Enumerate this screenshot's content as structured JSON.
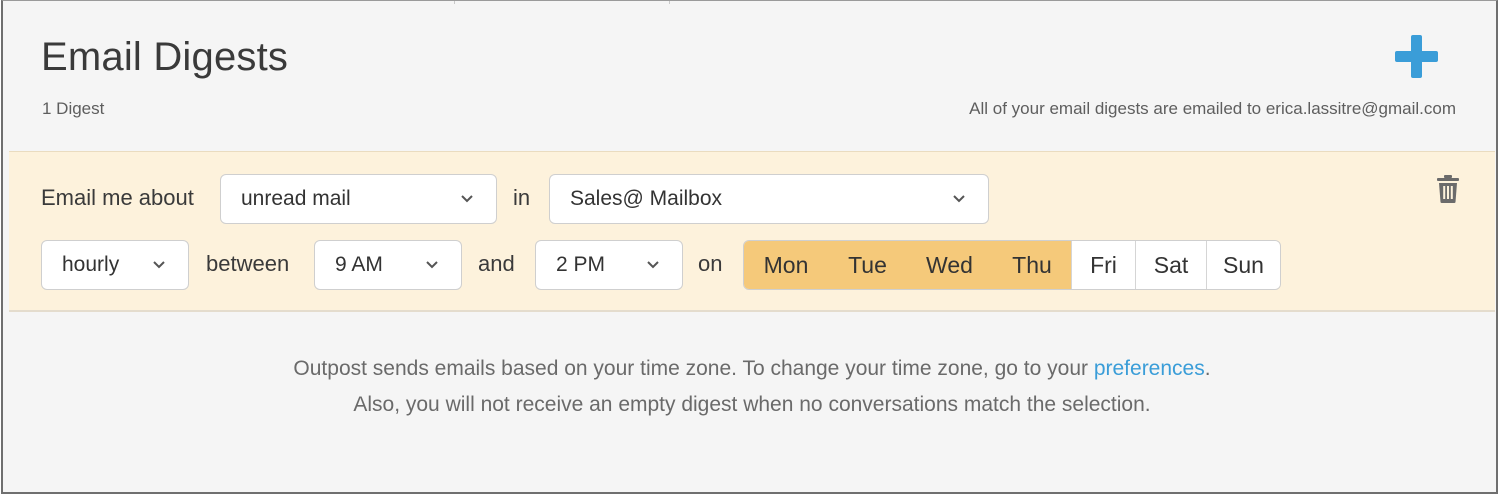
{
  "header": {
    "title": "Email Digests",
    "count_text": "1 Digest",
    "recipient_text": "All of your email digests are emailed to erica.lassitre@gmail.com",
    "add_icon": "plus-icon",
    "add_color": "#3a9dd8"
  },
  "digest": {
    "label_email_me_about": "Email me about",
    "topic_select": {
      "value": "unread mail"
    },
    "label_in": "in",
    "mailbox_select": {
      "value": "Sales@ Mailbox"
    },
    "frequency_select": {
      "value": "hourly"
    },
    "label_between": "between",
    "start_select": {
      "value": "9 AM"
    },
    "label_and": "and",
    "end_select": {
      "value": "2 PM"
    },
    "label_on": "on",
    "days": [
      {
        "label": "Mon",
        "selected": true
      },
      {
        "label": "Tue",
        "selected": true
      },
      {
        "label": "Wed",
        "selected": true
      },
      {
        "label": "Thu",
        "selected": true
      },
      {
        "label": "Fri",
        "selected": false
      },
      {
        "label": "Sat",
        "selected": false
      },
      {
        "label": "Sun",
        "selected": false
      }
    ],
    "delete_icon": "trash-icon",
    "panel_color": "#fdf2dc",
    "selected_day_color": "#f5c97a"
  },
  "footer": {
    "line1_before": "Outpost sends emails based on your time zone. To change your time zone, go to your ",
    "line1_link": "preferences",
    "line1_after": ".",
    "line2": "Also, you will not receive an empty digest when no conversations match the selection.",
    "link_color": "#3a9dd8"
  }
}
